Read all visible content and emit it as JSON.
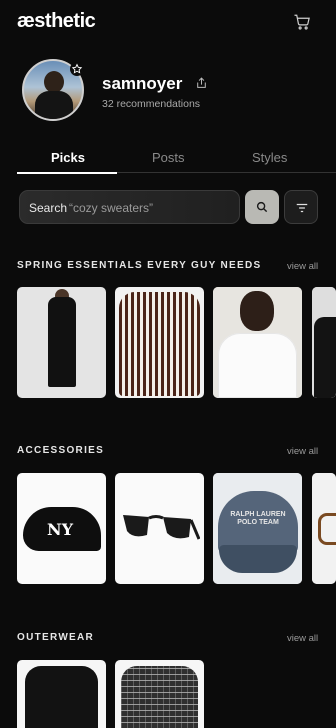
{
  "header": {
    "logo_text": "æsthetic",
    "cart_icon": "cart-icon"
  },
  "profile": {
    "username": "samnoyer",
    "recommendations": "32 recommendations"
  },
  "tabs": [
    {
      "label": "Picks",
      "active": true
    },
    {
      "label": "Posts",
      "active": false
    },
    {
      "label": "Styles",
      "active": false
    }
  ],
  "search": {
    "label": "Search",
    "placeholder": "“cozy sweaters”"
  },
  "sections": [
    {
      "title": "SPRING ESSENTIALS EVERY GUY NEEDS",
      "view_all": "view all"
    },
    {
      "title": "ACCESSORIES",
      "view_all": "view all"
    },
    {
      "title": "OUTERWEAR",
      "view_all": "view all"
    }
  ],
  "accessories": {
    "cap2_text": "RALPH LAUREN POLO TEAM"
  },
  "colors": {
    "background": "#0b0b0b",
    "search_button": "#b9b9b4",
    "muted_text": "#9a9a9a"
  }
}
